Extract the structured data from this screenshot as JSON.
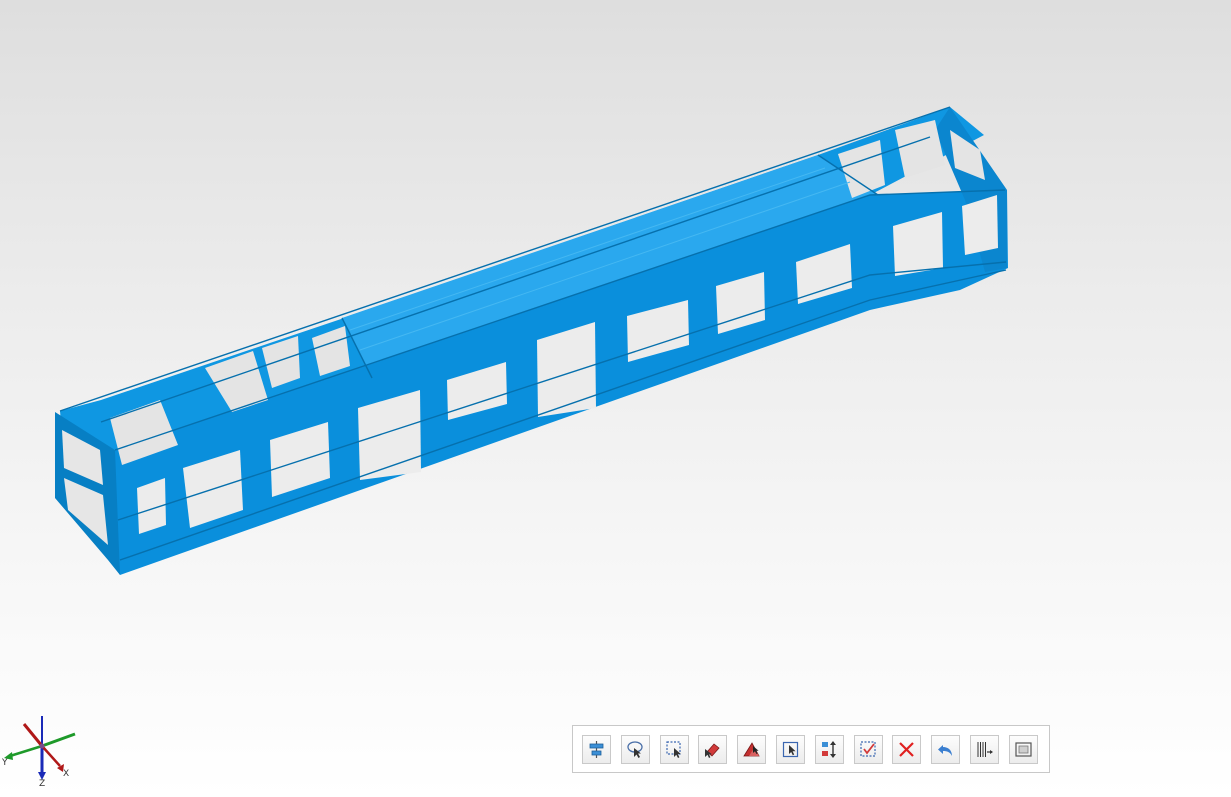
{
  "viewport": {
    "background_top": "#dedede",
    "background_bottom": "#ffffff",
    "model_color": "#0a93e0",
    "model_shadow": "#0773b4",
    "model_highlight": "#33aef0"
  },
  "axis_triad": {
    "labels": {
      "x": "X",
      "y": "Y",
      "z": "Z"
    },
    "colors": {
      "x": "#b01818",
      "y": "#1e9a2a",
      "z": "#1a2ab8"
    }
  },
  "toolbar": {
    "buttons": [
      {
        "name": "align-center-tool-button",
        "icon": "align-center-icon"
      },
      {
        "name": "lasso-select-tool-button",
        "icon": "lasso-select-icon"
      },
      {
        "name": "rectangle-select-tool-button",
        "icon": "rectangle-select-icon"
      },
      {
        "name": "deselect-tool-button",
        "icon": "eraser-select-icon"
      },
      {
        "name": "select-through-tool-button",
        "icon": "select-through-icon"
      },
      {
        "name": "select-visible-tool-button",
        "icon": "select-visible-icon"
      },
      {
        "name": "invert-selection-tool-button",
        "icon": "invert-selection-icon"
      },
      {
        "name": "select-all-tool-button",
        "icon": "select-all-icon"
      },
      {
        "name": "delete-tool-button",
        "icon": "delete-x-icon"
      },
      {
        "name": "undo-tool-button",
        "icon": "undo-arrow-icon"
      },
      {
        "name": "section-tool-button",
        "icon": "section-lines-icon"
      },
      {
        "name": "frame-view-tool-button",
        "icon": "frame-view-icon"
      }
    ]
  }
}
